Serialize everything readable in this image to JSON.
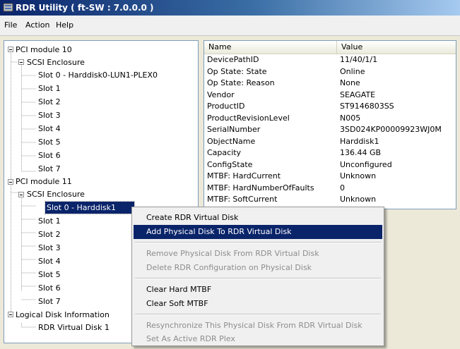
{
  "window": {
    "title": "RDR Utility ( ft-SW : 7.0.0.0 )"
  },
  "menu": [
    "File",
    "Action",
    "Help"
  ],
  "tree": [
    {
      "label": "PCI module 10"
    },
    {
      "label": "SCSI Enclosure"
    },
    {
      "label": "Slot 0  -  Harddisk0-LUN1-PLEX0"
    },
    {
      "label": "Slot 1"
    },
    {
      "label": "Slot 2"
    },
    {
      "label": "Slot 3"
    },
    {
      "label": "Slot 4"
    },
    {
      "label": "Slot 5"
    },
    {
      "label": "Slot 6"
    },
    {
      "label": "Slot 7"
    },
    {
      "label": "PCI module 11"
    },
    {
      "label": "SCSI Enclosure"
    },
    {
      "label": "Slot 0  -  Harddisk1",
      "selected": true
    },
    {
      "label": "Slot 1"
    },
    {
      "label": "Slot 2"
    },
    {
      "label": "Slot 3"
    },
    {
      "label": "Slot 4"
    },
    {
      "label": "Slot 5"
    },
    {
      "label": "Slot 6"
    },
    {
      "label": "Slot 7"
    },
    {
      "label": "Logical Disk Information"
    },
    {
      "label": "RDR Virtual Disk 1"
    }
  ],
  "properties": {
    "columns": [
      "Name",
      "Value"
    ],
    "rows": [
      {
        "name": "DevicePathID",
        "value": "11/40/1/1"
      },
      {
        "name": "Op State: State",
        "value": "Online"
      },
      {
        "name": "Op State: Reason",
        "value": "None"
      },
      {
        "name": "Vendor",
        "value": "SEAGATE"
      },
      {
        "name": "ProductID",
        "value": "ST9146803SS"
      },
      {
        "name": "ProductRevisionLevel",
        "value": "N005"
      },
      {
        "name": "SerialNumber",
        "value": "3SD024KP00009923WJ0M"
      },
      {
        "name": "ObjectName",
        "value": "Harddisk1"
      },
      {
        "name": "Capacity",
        "value": "136.44 GB"
      },
      {
        "name": "ConfigState",
        "value": "Unconfigured"
      },
      {
        "name": "MTBF: HardCurrent",
        "value": "Unknown"
      },
      {
        "name": "MTBF: HardNumberOfFaults",
        "value": "0"
      },
      {
        "name": "MTBF: SoftCurrent",
        "value": "Unknown"
      }
    ]
  },
  "context_menu": [
    {
      "label": "Create RDR Virtual Disk",
      "state": "enabled"
    },
    {
      "label": "Add Physical Disk To RDR Virtual Disk",
      "state": "highlighted"
    },
    {
      "label": "Remove Physical Disk From RDR Virtual Disk",
      "state": "disabled"
    },
    {
      "label": "Delete RDR Configuration on Physical Disk",
      "state": "disabled"
    },
    {
      "label": "Clear Hard MTBF",
      "state": "enabled"
    },
    {
      "label": "Clear Soft MTBF",
      "state": "enabled"
    },
    {
      "label": "Resynchronize This Physical Disk From RDR Virtual Disk",
      "state": "disabled"
    },
    {
      "label": "Set As Active RDR Plex",
      "state": "disabled"
    }
  ],
  "colors": {
    "selection": "#0a246a",
    "titlebar": "#0a246a",
    "disabled_text": "#8d8d8d"
  }
}
